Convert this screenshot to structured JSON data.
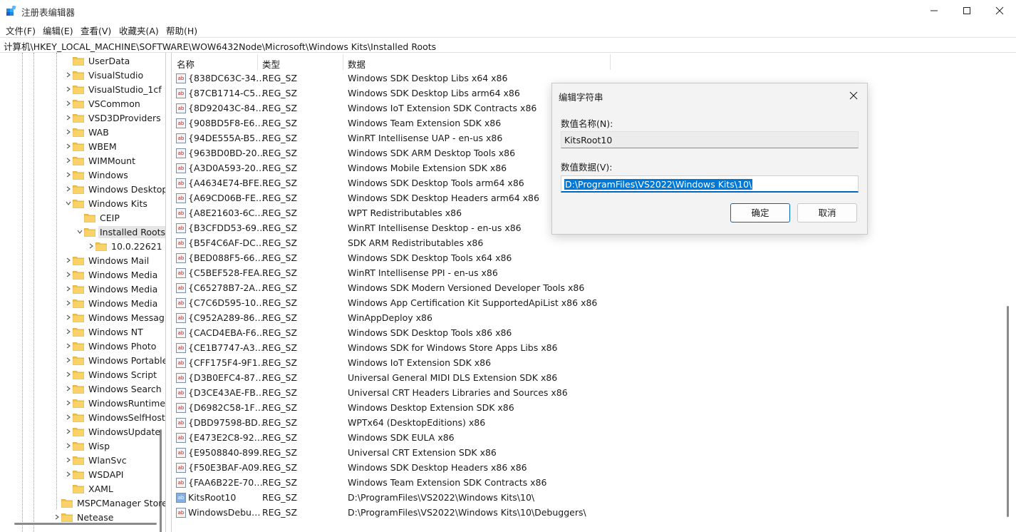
{
  "window": {
    "title": "注册表编辑器",
    "minimize": "—",
    "maximize": "☐",
    "close": "✕"
  },
  "menu": [
    "文件(F)",
    "编辑(E)",
    "查看(V)",
    "收藏夹(A)",
    "帮助(H)"
  ],
  "address": "计算机\\HKEY_LOCAL_MACHINE\\SOFTWARE\\WOW6432Node\\Microsoft\\Windows Kits\\Installed Roots",
  "tree": [
    {
      "label": "UserData",
      "level": 2,
      "expander": "none"
    },
    {
      "label": "VisualStudio",
      "level": 2,
      "expander": "collapsed"
    },
    {
      "label": "VisualStudio_1cf",
      "level": 2,
      "expander": "collapsed"
    },
    {
      "label": "VSCommon",
      "level": 2,
      "expander": "collapsed"
    },
    {
      "label": "VSD3DProviders",
      "level": 2,
      "expander": "collapsed"
    },
    {
      "label": "WAB",
      "level": 2,
      "expander": "collapsed"
    },
    {
      "label": "WBEM",
      "level": 2,
      "expander": "collapsed"
    },
    {
      "label": "WIMMount",
      "level": 2,
      "expander": "collapsed"
    },
    {
      "label": "Windows",
      "level": 2,
      "expander": "collapsed"
    },
    {
      "label": "Windows Desktop",
      "level": 2,
      "expander": "collapsed"
    },
    {
      "label": "Windows Kits",
      "level": 2,
      "expander": "expanded"
    },
    {
      "label": "CEIP",
      "level": 3,
      "expander": "none"
    },
    {
      "label": "Installed Roots",
      "level": 3,
      "expander": "expanded",
      "selected": true
    },
    {
      "label": "10.0.22621",
      "level": 4,
      "expander": "collapsed"
    },
    {
      "label": "Windows Mail",
      "level": 2,
      "expander": "collapsed"
    },
    {
      "label": "Windows Media",
      "level": 2,
      "expander": "collapsed"
    },
    {
      "label": "Windows Media",
      "level": 2,
      "expander": "collapsed"
    },
    {
      "label": "Windows Media",
      "level": 2,
      "expander": "collapsed"
    },
    {
      "label": "Windows Messaging",
      "level": 2,
      "expander": "collapsed"
    },
    {
      "label": "Windows NT",
      "level": 2,
      "expander": "collapsed"
    },
    {
      "label": "Windows Photo",
      "level": 2,
      "expander": "collapsed"
    },
    {
      "label": "Windows Portable",
      "level": 2,
      "expander": "collapsed"
    },
    {
      "label": "Windows Script",
      "level": 2,
      "expander": "collapsed"
    },
    {
      "label": "Windows Search",
      "level": 2,
      "expander": "collapsed"
    },
    {
      "label": "WindowsRuntime",
      "level": 2,
      "expander": "collapsed"
    },
    {
      "label": "WindowsSelfHost",
      "level": 2,
      "expander": "collapsed"
    },
    {
      "label": "WindowsUpdate",
      "level": 2,
      "expander": "collapsed"
    },
    {
      "label": "Wisp",
      "level": 2,
      "expander": "collapsed"
    },
    {
      "label": "WlanSvc",
      "level": 2,
      "expander": "collapsed"
    },
    {
      "label": "WSDAPI",
      "level": 2,
      "expander": "collapsed"
    },
    {
      "label": "XAML",
      "level": 2,
      "expander": "none"
    },
    {
      "label": "MSPCManager Store",
      "level": 1,
      "expander": "none"
    },
    {
      "label": "Netease",
      "level": 1,
      "expander": "collapsed"
    }
  ],
  "columns": {
    "name": "名称",
    "type": "类型",
    "data": "数据"
  },
  "values": [
    {
      "icon": "string",
      "name": "{838DC63C-34…",
      "type": "REG_SZ",
      "data": "Windows SDK Desktop Libs x64 x86"
    },
    {
      "icon": "string",
      "name": "{87CB1714-C5…",
      "type": "REG_SZ",
      "data": "Windows SDK Desktop Libs arm64 x86"
    },
    {
      "icon": "string",
      "name": "{8D92043C-84…",
      "type": "REG_SZ",
      "data": "Windows IoT Extension SDK Contracts x86"
    },
    {
      "icon": "string",
      "name": "{908BD5F8-E6…",
      "type": "REG_SZ",
      "data": "Windows Team Extension SDK x86"
    },
    {
      "icon": "string",
      "name": "{94DE555A-B5…",
      "type": "REG_SZ",
      "data": "WinRT Intellisense UAP - en-us x86"
    },
    {
      "icon": "string",
      "name": "{963BD0BD-20…",
      "type": "REG_SZ",
      "data": "Windows SDK ARM Desktop Tools x86"
    },
    {
      "icon": "string",
      "name": "{A3D0A593-20…",
      "type": "REG_SZ",
      "data": "Windows Mobile Extension SDK x86"
    },
    {
      "icon": "string",
      "name": "{A4634E74-BFE…",
      "type": "REG_SZ",
      "data": "Windows SDK Desktop Tools arm64 x86"
    },
    {
      "icon": "string",
      "name": "{A69CD06B-FE…",
      "type": "REG_SZ",
      "data": "Windows SDK Desktop Headers arm64 x86"
    },
    {
      "icon": "string",
      "name": "{A8E21603-6C…",
      "type": "REG_SZ",
      "data": "WPT Redistributables x86"
    },
    {
      "icon": "string",
      "name": "{B3CFDD53-69…",
      "type": "REG_SZ",
      "data": "WinRT Intellisense Desktop - en-us x86"
    },
    {
      "icon": "string",
      "name": "{B5F4C6AF-DC…",
      "type": "REG_SZ",
      "data": "SDK ARM Redistributables x86"
    },
    {
      "icon": "string",
      "name": "{BED088F5-66…",
      "type": "REG_SZ",
      "data": "Windows SDK Desktop Tools x64 x86"
    },
    {
      "icon": "string",
      "name": "{C5BEF528-FEA…",
      "type": "REG_SZ",
      "data": "WinRT Intellisense PPI - en-us x86"
    },
    {
      "icon": "string",
      "name": "{C65278B7-2A…",
      "type": "REG_SZ",
      "data": "Windows SDK Modern Versioned Developer Tools x86"
    },
    {
      "icon": "string",
      "name": "{C7C6D595-10…",
      "type": "REG_SZ",
      "data": "Windows App Certification Kit SupportedApiList x86 x86"
    },
    {
      "icon": "string",
      "name": "{C952A289-86…",
      "type": "REG_SZ",
      "data": "WinAppDeploy x86"
    },
    {
      "icon": "string",
      "name": "{CACD4EBA-F6…",
      "type": "REG_SZ",
      "data": "Windows SDK Desktop Tools x86 x86"
    },
    {
      "icon": "string",
      "name": "{CE1B7747-A3…",
      "type": "REG_SZ",
      "data": "Windows SDK for Windows Store Apps Libs x86"
    },
    {
      "icon": "string",
      "name": "{CFF175F4-9F1…",
      "type": "REG_SZ",
      "data": "Windows IoT Extension SDK x86"
    },
    {
      "icon": "string",
      "name": "{D3B0EFC4-87…",
      "type": "REG_SZ",
      "data": "Universal General MIDI DLS Extension SDK x86"
    },
    {
      "icon": "string",
      "name": "{D3CE43AE-FB…",
      "type": "REG_SZ",
      "data": "Universal CRT Headers Libraries and Sources x86"
    },
    {
      "icon": "string",
      "name": "{D6982C58-1F…",
      "type": "REG_SZ",
      "data": "Windows Desktop Extension SDK x86"
    },
    {
      "icon": "string",
      "name": "{DBD97598-BD…",
      "type": "REG_SZ",
      "data": "WPTx64 (DesktopEditions) x86"
    },
    {
      "icon": "string",
      "name": "{E473E2C8-92…",
      "type": "REG_SZ",
      "data": "Windows SDK EULA x86"
    },
    {
      "icon": "string",
      "name": "{E9508840-899…",
      "type": "REG_SZ",
      "data": "Universal CRT Extension SDK x86"
    },
    {
      "icon": "string",
      "name": "{F50E3BAF-A09…",
      "type": "REG_SZ",
      "data": "Windows SDK Desktop Headers x86 x86"
    },
    {
      "icon": "string",
      "name": "{FAA6B22E-70…",
      "type": "REG_SZ",
      "data": "Windows Team Extension SDK Contracts x86"
    },
    {
      "icon": "string-blue",
      "name": "KitsRoot10",
      "type": "REG_SZ",
      "data": "D:\\ProgramFiles\\VS2022\\Windows Kits\\10\\"
    },
    {
      "icon": "string",
      "name": "WindowsDebu…",
      "type": "REG_SZ",
      "data": "D:\\ProgramFiles\\VS2022\\Windows Kits\\10\\Debuggers\\"
    }
  ],
  "dialog": {
    "title": "编辑字符串",
    "close": "✕",
    "name_label": "数值名称(N):",
    "name_value": "KitsRoot10",
    "data_label": "数值数据(V):",
    "data_value": "D:\\ProgramFiles\\VS2022\\Windows Kits\\10\\",
    "ok": "确定",
    "cancel": "取消"
  },
  "colors": {
    "accent": "#0067c0",
    "selection": "#0078d7",
    "folder": "#f2c14e",
    "folder_dark": "#d9a22e"
  }
}
